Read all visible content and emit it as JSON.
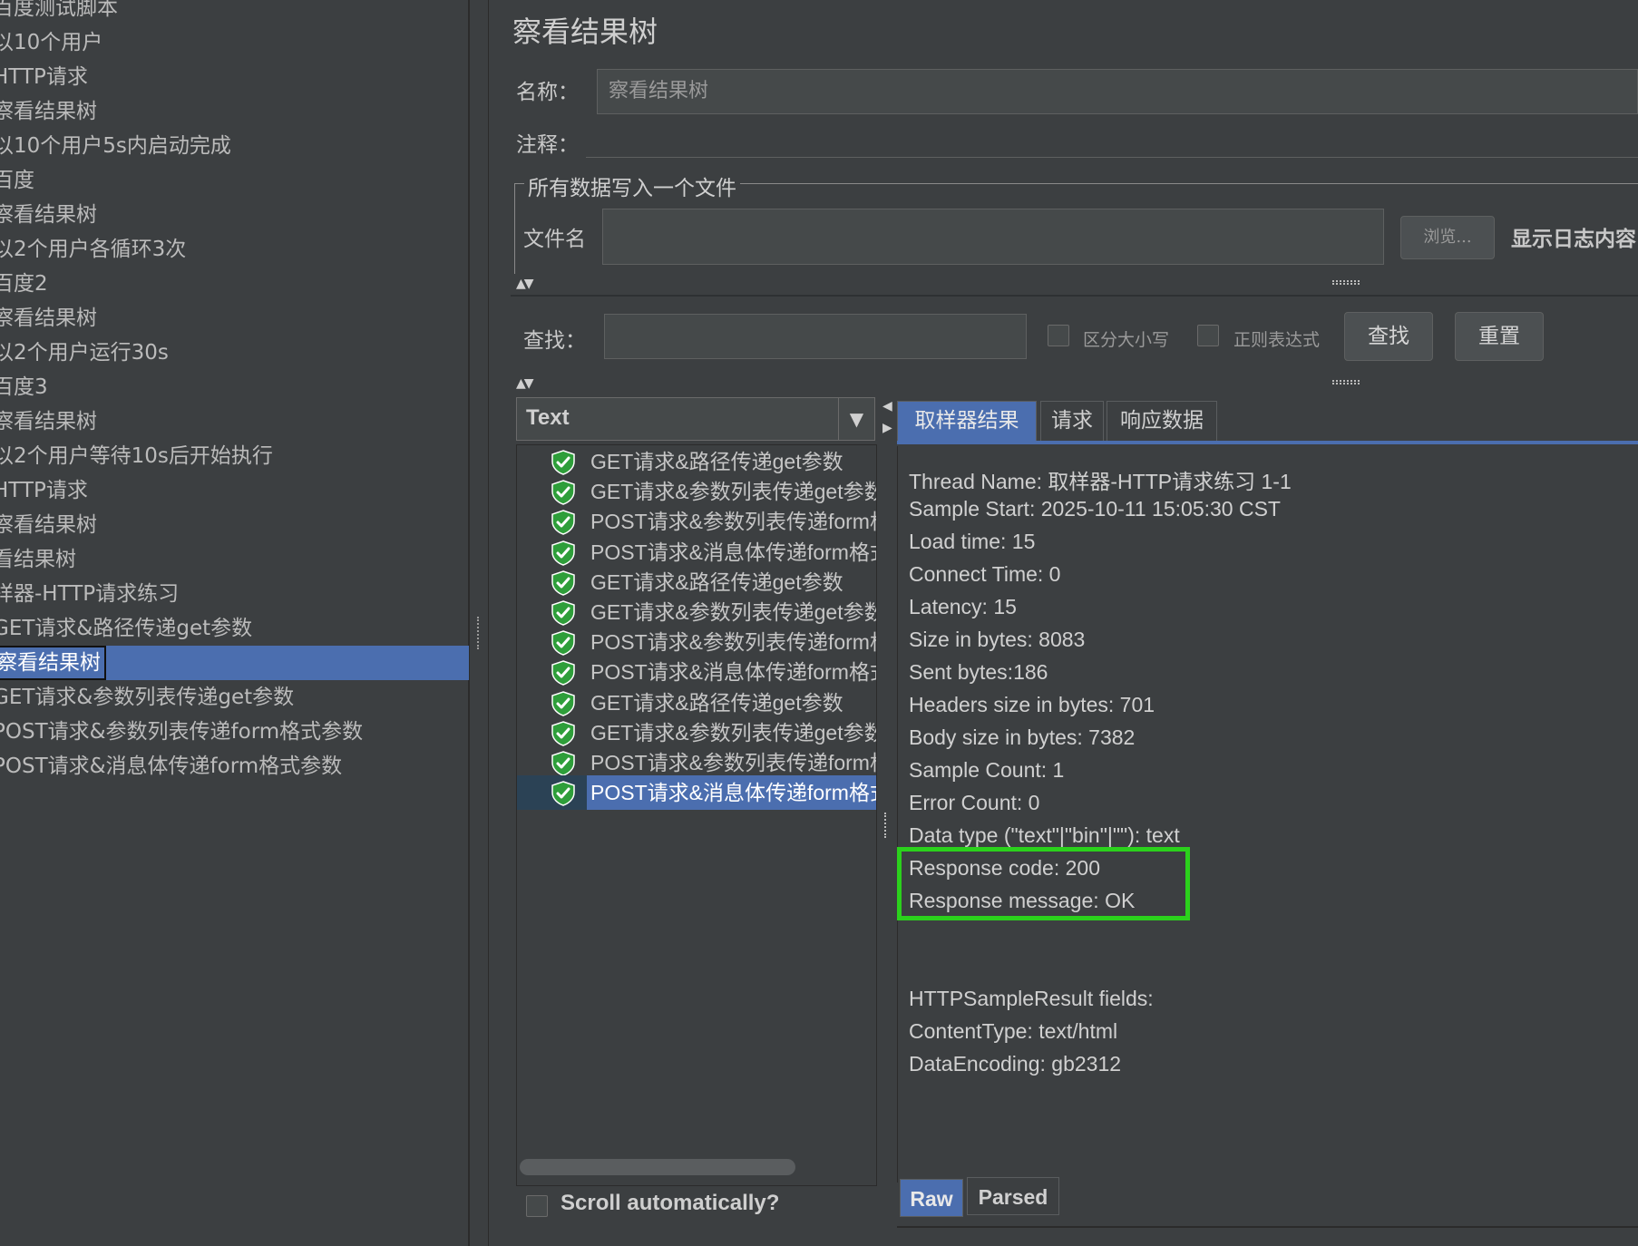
{
  "tree": {
    "items": [
      {
        "label": "百度测试脚本"
      },
      {
        "label": "以10个用户"
      },
      {
        "label": "HTTP请求"
      },
      {
        "label": "察看结果树"
      },
      {
        "label": "以10个用户5s内启动完成"
      },
      {
        "label": "百度"
      },
      {
        "label": "察看结果树"
      },
      {
        "label": "以2个用户各循环3次"
      },
      {
        "label": "百度2"
      },
      {
        "label": "察看结果树"
      },
      {
        "label": "以2个用户运行30s"
      },
      {
        "label": "百度3"
      },
      {
        "label": "察看结果树"
      },
      {
        "label": "以2个用户等待10s后开始执行"
      },
      {
        "label": "HTTP请求"
      },
      {
        "label": "察看结果树"
      },
      {
        "label": "看结果树"
      },
      {
        "label": "样器-HTTP请求练习"
      },
      {
        "label": "GET请求&路径传递get参数"
      },
      {
        "label": "察看结果树"
      },
      {
        "label": "GET请求&参数列表传递get参数"
      },
      {
        "label": "POST请求&参数列表传递form格式参数"
      },
      {
        "label": "POST请求&消息体传递form格式参数"
      }
    ],
    "selected_index": 19
  },
  "panel": {
    "title": "察看结果树",
    "name_label": "名称：",
    "name_value": "察看结果树",
    "comment_label": "注释：",
    "file_group_legend": "所有数据写入一个文件",
    "file_label": "文件名",
    "browse_button": "浏览...",
    "log_label": "显示日志内容"
  },
  "search": {
    "label": "查找：",
    "case_label": "区分大小写",
    "regex_label": "正则表达式",
    "find_button": "查找",
    "reset_button": "重置"
  },
  "renderer": {
    "selected": "Text"
  },
  "results": [
    {
      "label": "GET请求&路径传递get参数"
    },
    {
      "label": "GET请求&参数列表传递get参数"
    },
    {
      "label": "POST请求&参数列表传递form格式参数"
    },
    {
      "label": "POST请求&消息体传递form格式参数"
    },
    {
      "label": "GET请求&路径传递get参数"
    },
    {
      "label": "GET请求&参数列表传递get参数"
    },
    {
      "label": "POST请求&参数列表传递form格式参数"
    },
    {
      "label": "POST请求&消息体传递form格式参数"
    },
    {
      "label": "GET请求&路径传递get参数"
    },
    {
      "label": "GET请求&参数列表传递get参数"
    },
    {
      "label": "POST请求&参数列表传递form格式参数"
    },
    {
      "label": "POST请求&消息体传递form格式参数"
    }
  ],
  "results_selected_index": 11,
  "scroll_auto_label": "Scroll automatically?",
  "tabs": [
    {
      "label": "取样器结果",
      "active": true
    },
    {
      "label": "请求",
      "active": false
    },
    {
      "label": "响应数据",
      "active": false
    }
  ],
  "details": [
    "Thread Name: 取样器-HTTP请求练习 1-1",
    "Sample Start: 2025-10-11 15:05:30 CST",
    "Load time: 15",
    "Connect Time: 0",
    "Latency: 15",
    "Size in bytes: 8083",
    "Sent bytes:186",
    "Headers size in bytes: 701",
    "Body size in bytes: 7382",
    "Sample Count: 1",
    "Error Count: 0",
    "Data type (\"text\"|\"bin\"|\"\"): text",
    "Response code: 200",
    "Response message: OK",
    "",
    "",
    "HTTPSampleResult fields:",
    "ContentType: text/html",
    "DataEncoding: gb2312"
  ],
  "bottom_tabs": [
    {
      "label": "Raw",
      "active": true
    },
    {
      "label": "Parsed",
      "active": false
    }
  ],
  "colors": {
    "selection": "#4b6eaf",
    "highlight_box": "#2bd11c",
    "success_shield": "#2e9e3a"
  }
}
